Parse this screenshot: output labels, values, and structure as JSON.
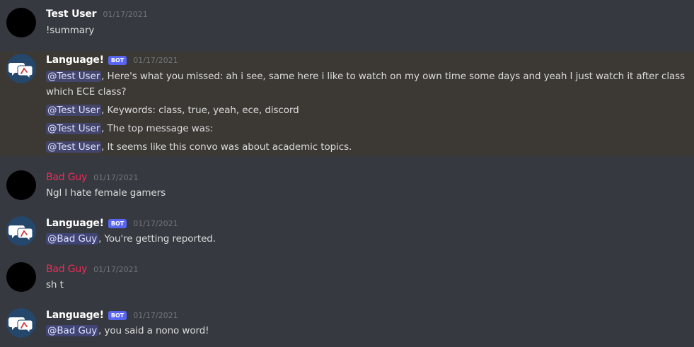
{
  "messages": [
    {
      "author": "Test User",
      "timestamp": "01/17/2021",
      "lines": [
        {
          "text": "!summary"
        }
      ]
    },
    {
      "author": "Language!",
      "badge": "BOT",
      "timestamp": "01/17/2021",
      "lines": [
        {
          "mention": "@Test User",
          "text": ", Here's what you missed: ah i see, same here i like to watch on my own time some days and yeah I just watch it after class"
        },
        {
          "text": "which ECE class?"
        },
        {
          "mention": "@Test User",
          "text": ", Keywords: class, true, yeah, ece, discord"
        },
        {
          "mention": "@Test User",
          "text": ", The top message was:"
        },
        {
          "mention": "@Test User",
          "text": ", It seems like this convo was about academic topics."
        }
      ]
    },
    {
      "author": "Bad Guy",
      "timestamp": "01/17/2021",
      "lines": [
        {
          "text": "Ngl I hate female gamers"
        }
      ]
    },
    {
      "author": "Language!",
      "badge": "BOT",
      "timestamp": "01/17/2021",
      "lines": [
        {
          "mention": "@Bad Guy",
          "text": ", You're getting reported."
        }
      ]
    },
    {
      "author": "Bad Guy",
      "timestamp": "01/17/2021",
      "lines": [
        {
          "text": "sh t"
        }
      ]
    },
    {
      "author": "Language!",
      "badge": "BOT",
      "timestamp": "01/17/2021",
      "lines": [
        {
          "mention": "@Bad Guy",
          "text": ", you said a nono word!"
        }
      ]
    }
  ],
  "colors": {
    "background": "#36393f",
    "highlight": "#3c3833",
    "mention_bg": "#4b4f8a",
    "bot_badge": "#5865f2",
    "bad_guy_name": "#ed2c5a",
    "bot_avatar_bg": "#24476b"
  },
  "icons": {
    "user_avatar": "black-circle-avatar",
    "bot_avatar": "speech-bubbles-icon"
  }
}
